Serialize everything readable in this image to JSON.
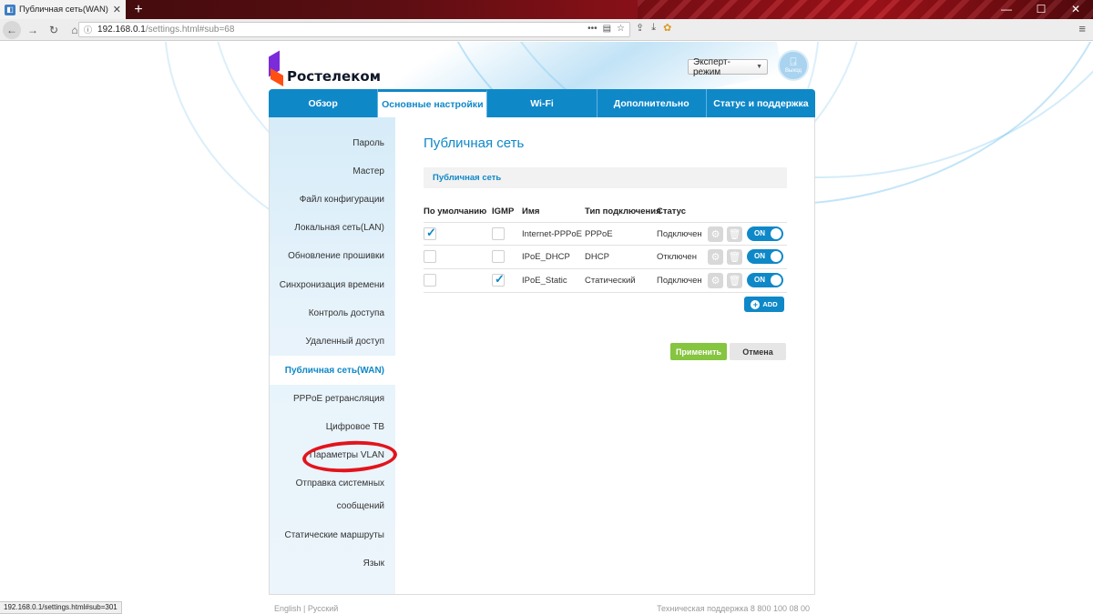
{
  "browser": {
    "tab_title": "Публичная сеть(WAN)",
    "tab_close": "✕",
    "new_tab": "+",
    "url_host": "192.168.0.1",
    "url_path": "/settings.html#sub=68",
    "status_url": "192.168.0.1/settings.html#sub=301"
  },
  "brand": {
    "name": "Ростелеком",
    "colors": {
      "accent": "#0f88c8",
      "logo_purple": "#7b2bd9",
      "logo_orange": "#ff4f12",
      "apply_green": "#86c540"
    }
  },
  "header": {
    "mode_value": "Эксперт-режим",
    "exit_label": "Выход"
  },
  "main_tabs": [
    {
      "label": "Обзор"
    },
    {
      "label": "Основные настройки",
      "active": true
    },
    {
      "label": "Wi-Fi"
    },
    {
      "label": "Дополнительно"
    },
    {
      "label": "Статус и поддержка"
    }
  ],
  "sidebar": {
    "items": [
      "Пароль",
      "Мастер",
      "Файл конфигурации",
      "Локальная сеть(LAN)",
      "Обновление прошивки",
      "Синхронизация времени",
      "Контроль доступа",
      "Удаленный доступ",
      "Публичная сеть(WAN)",
      "PPPoE ретрансляция",
      "Цифровое ТВ",
      "Параметры VLAN",
      "Отправка системных",
      "сообщений",
      "Статические маршруты",
      "Язык"
    ],
    "active_item": "Публичная сеть(WAN)",
    "highlighted_item": "Параметры VLAN"
  },
  "content": {
    "title": "Публичная сеть",
    "section_label": "Публичная сеть",
    "columns": {
      "default": "По умолчанию",
      "igmp": "IGMP",
      "name": "Имя",
      "type": "Тип подключения",
      "status": "Статус"
    },
    "rows": [
      {
        "default": true,
        "igmp": false,
        "name": "Internet-PPPoE",
        "type": "PPPoE",
        "status": "Подключен",
        "toggle": "ON"
      },
      {
        "default": false,
        "igmp": false,
        "name": "IPoE_DHCP",
        "type": "DHCP",
        "status": "Отключен",
        "toggle": "ON"
      },
      {
        "default": false,
        "igmp": true,
        "name": "IPoE_Static",
        "type": "Статический",
        "status": "Подключен",
        "toggle": "ON"
      }
    ],
    "add_label": "ADD",
    "apply_label": "Применить",
    "cancel_label": "Отмена"
  },
  "footer": {
    "lang_en": "English",
    "lang_sep": "|",
    "lang_ru": "Русский",
    "support": "Техническая поддержка 8 800 100 08 00"
  }
}
